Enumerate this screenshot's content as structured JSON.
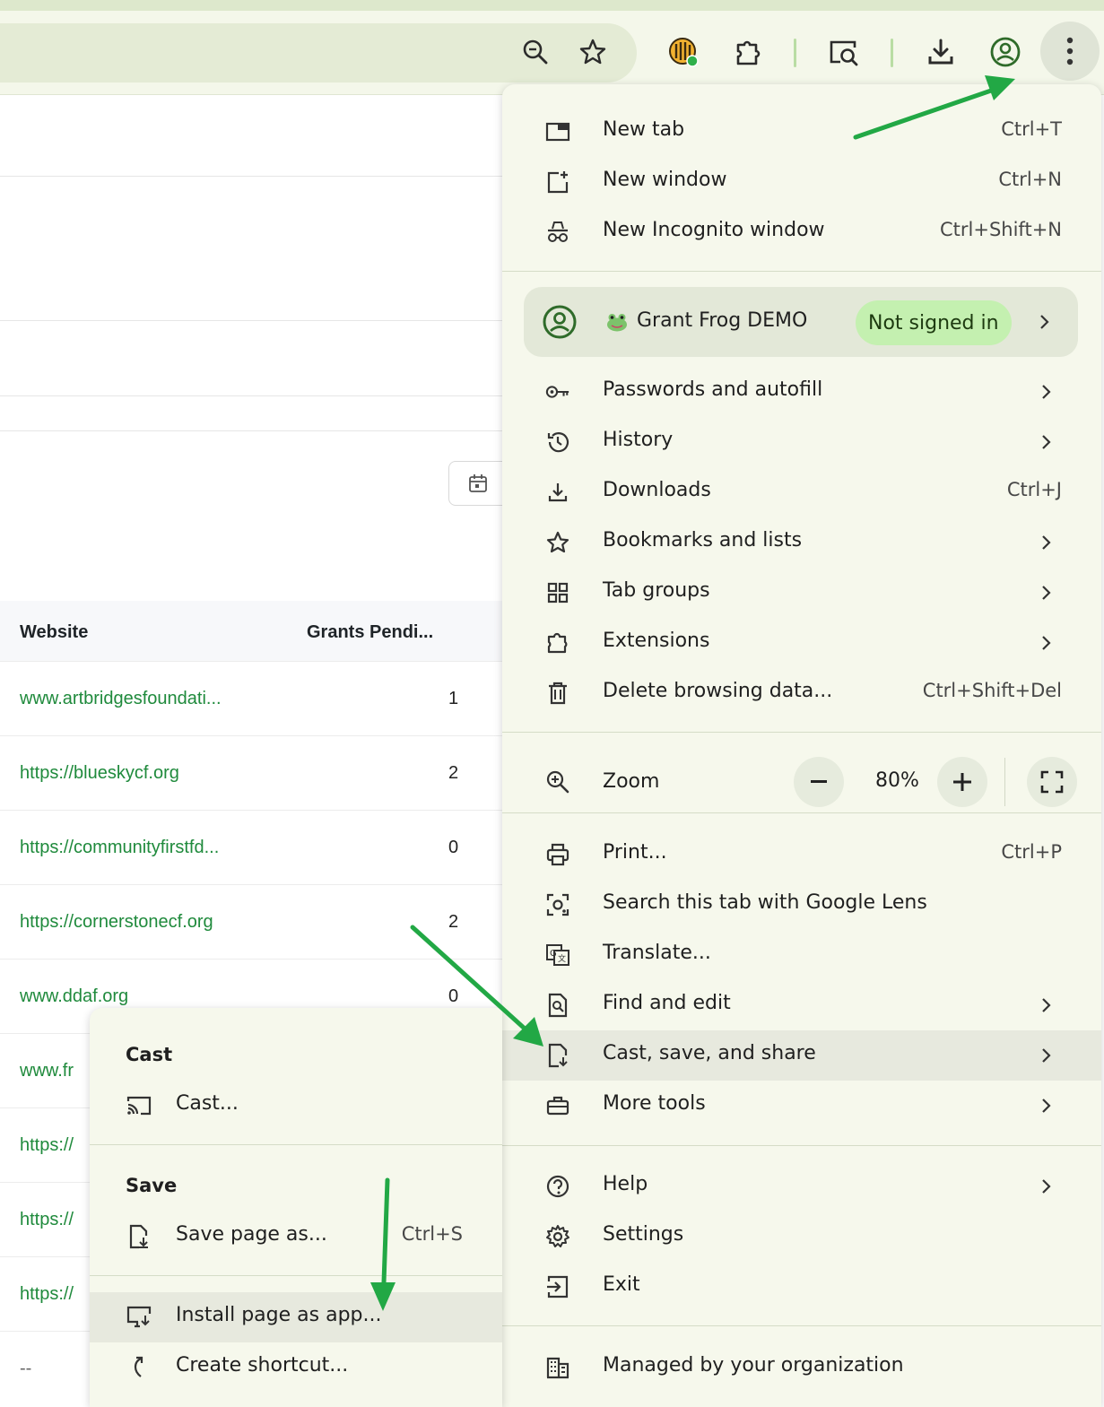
{
  "toolbar": {
    "icons": [
      "zoom-icon",
      "bookmark-star-icon",
      "extension-logo-icon",
      "extensions-puzzle-icon",
      "lens-search-icon",
      "downloads-icon",
      "profile-icon",
      "more-menu-icon"
    ]
  },
  "table": {
    "headers": [
      "Website",
      "Grants Pendi..."
    ],
    "rows": [
      {
        "website": "www.artbridgesfoundati...",
        "grants": "1"
      },
      {
        "website": "https://blueskycf.org",
        "grants": "2"
      },
      {
        "website": "https://communityfirstfd...",
        "grants": "0"
      },
      {
        "website": "https://cornerstonecf.org",
        "grants": "2"
      },
      {
        "website": "www.ddaf.org",
        "grants": "0"
      },
      {
        "website": "www.fr",
        "grants": ""
      },
      {
        "website": "https://",
        "grants": ""
      },
      {
        "website": "https://",
        "grants": ""
      },
      {
        "website": "https://",
        "grants": ""
      },
      {
        "website": "--",
        "grants": ""
      }
    ]
  },
  "menu": {
    "new_tab": {
      "label": "New tab",
      "shortcut": "Ctrl+T"
    },
    "new_window": {
      "label": "New window",
      "shortcut": "Ctrl+N"
    },
    "new_incognito": {
      "label": "New Incognito window",
      "shortcut": "Ctrl+Shift+N"
    },
    "profile": {
      "name": "Grant Frog DEMO",
      "status": "Not signed in"
    },
    "passwords": {
      "label": "Passwords and autofill"
    },
    "history": {
      "label": "History"
    },
    "downloads": {
      "label": "Downloads",
      "shortcut": "Ctrl+J"
    },
    "bookmarks": {
      "label": "Bookmarks and lists"
    },
    "tab_groups": {
      "label": "Tab groups"
    },
    "extensions": {
      "label": "Extensions"
    },
    "delete_data": {
      "label": "Delete browsing data...",
      "shortcut": "Ctrl+Shift+Del"
    },
    "zoom": {
      "label": "Zoom",
      "value": "80%"
    },
    "print": {
      "label": "Print...",
      "shortcut": "Ctrl+P"
    },
    "lens": {
      "label": "Search this tab with Google Lens"
    },
    "translate": {
      "label": "Translate..."
    },
    "find_edit": {
      "label": "Find and edit"
    },
    "cast_save_share": {
      "label": "Cast, save, and share"
    },
    "more_tools": {
      "label": "More tools"
    },
    "help": {
      "label": "Help"
    },
    "settings": {
      "label": "Settings"
    },
    "exit": {
      "label": "Exit"
    },
    "managed": {
      "label": "Managed by your organization"
    }
  },
  "submenu": {
    "cast_heading": "Cast",
    "cast": {
      "label": "Cast..."
    },
    "save_heading": "Save",
    "save_page": {
      "label": "Save page as...",
      "shortcut": "Ctrl+S"
    },
    "install_app": {
      "label": "Install page as app..."
    },
    "create_shortcut": {
      "label": "Create shortcut..."
    }
  },
  "colors": {
    "accent": "#1f8a3c",
    "menu_bg": "#f6f8ec",
    "badge_bg": "#c4f0b0",
    "arrow": "#22a845"
  }
}
